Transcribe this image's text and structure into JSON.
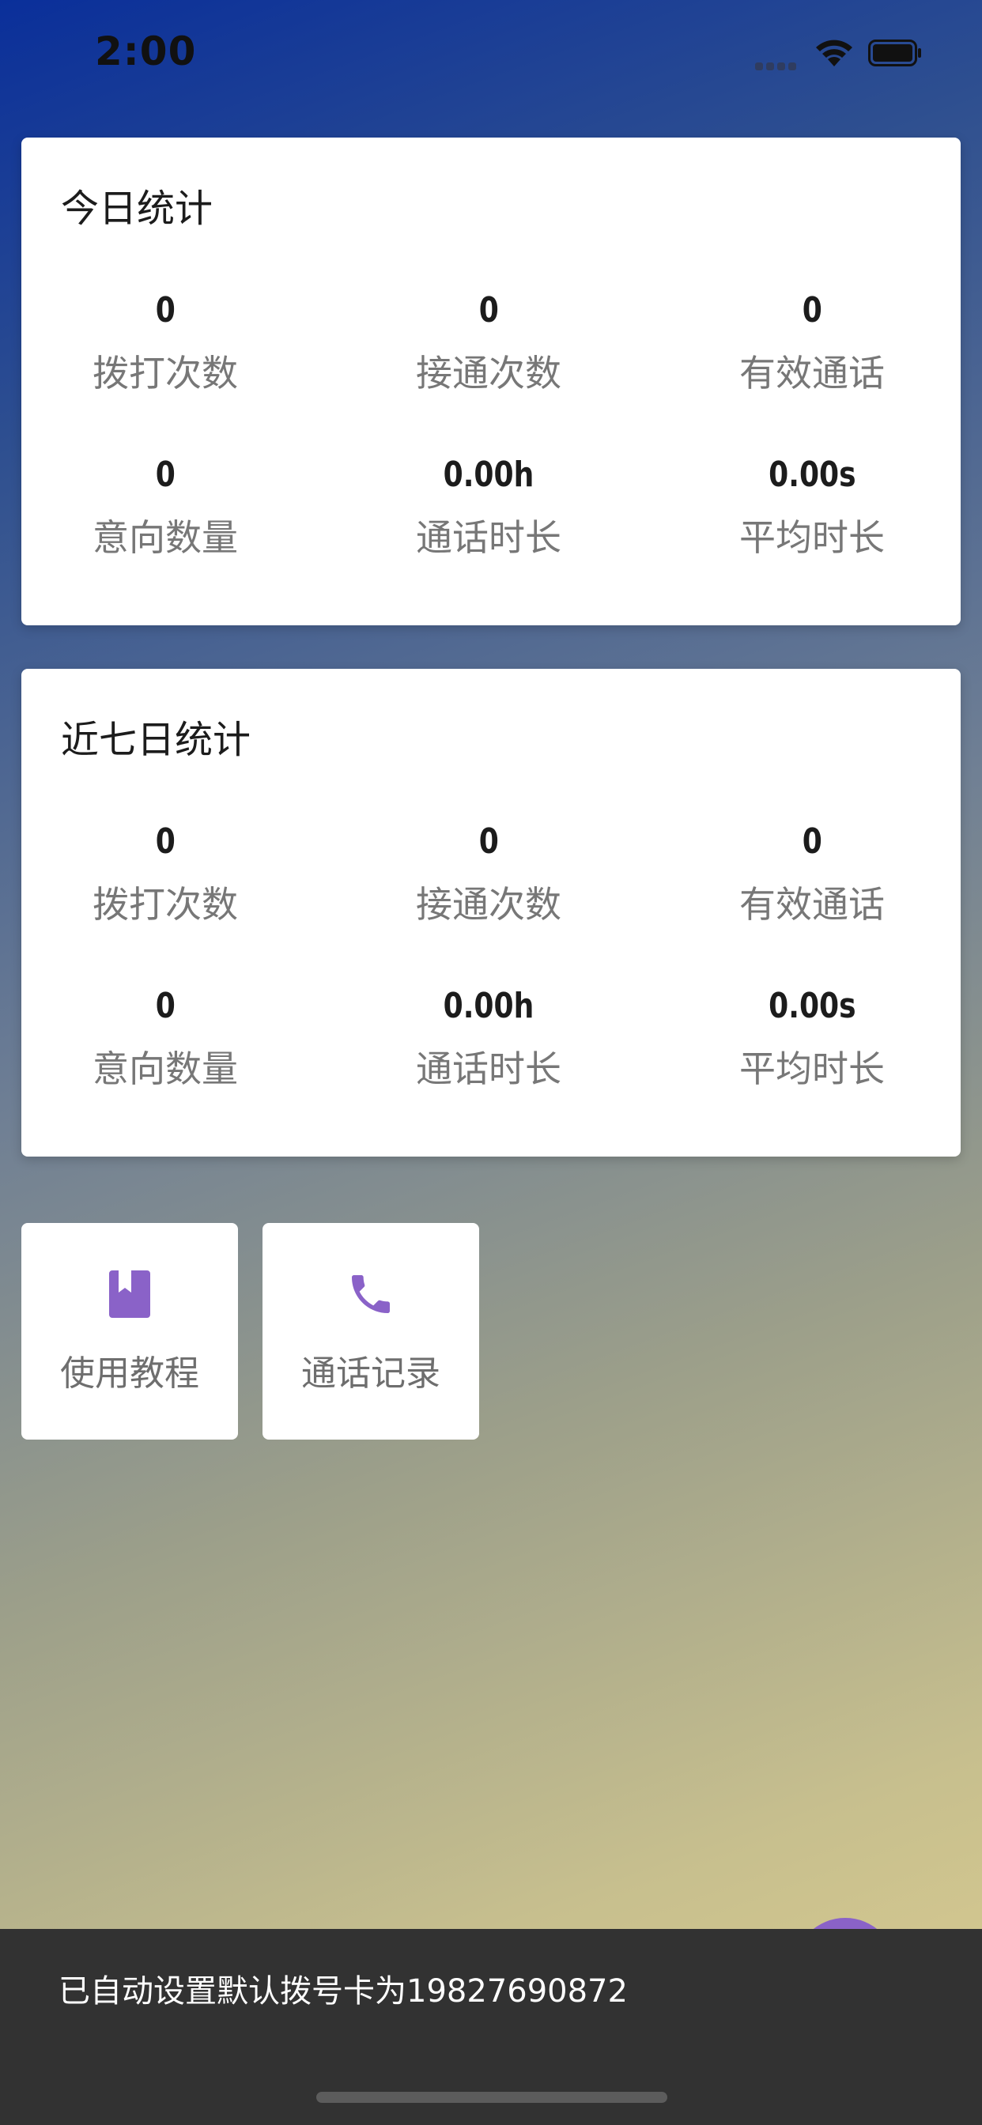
{
  "status_bar": {
    "time": "2:00"
  },
  "today_card": {
    "title": "今日统计",
    "stats": [
      {
        "value": "0",
        "label": "拨打次数"
      },
      {
        "value": "0",
        "label": "接通次数"
      },
      {
        "value": "0",
        "label": "有效通话"
      },
      {
        "value": "0",
        "label": "意向数量"
      },
      {
        "value": "0.00h",
        "label": "通话时长"
      },
      {
        "value": "0.00s",
        "label": "平均时长"
      }
    ]
  },
  "week_card": {
    "title": "近七日统计",
    "stats": [
      {
        "value": "0",
        "label": "拨打次数"
      },
      {
        "value": "0",
        "label": "接通次数"
      },
      {
        "value": "0",
        "label": "有效通话"
      },
      {
        "value": "0",
        "label": "意向数量"
      },
      {
        "value": "0.00h",
        "label": "通话时长"
      },
      {
        "value": "0.00s",
        "label": "平均时长"
      }
    ]
  },
  "tiles": [
    {
      "label": "使用教程",
      "icon": "book-icon"
    },
    {
      "label": "通话记录",
      "icon": "phone-icon"
    }
  ],
  "snackbar": {
    "message": "已自动设置默认拨号卡为19827690872"
  },
  "colors": {
    "accent": "#8a62c8",
    "snackbar_bg": "#323232",
    "card_bg": "#ffffff",
    "gradient_top": "#0a2f9a",
    "gradient_bottom": "#dccd90"
  }
}
